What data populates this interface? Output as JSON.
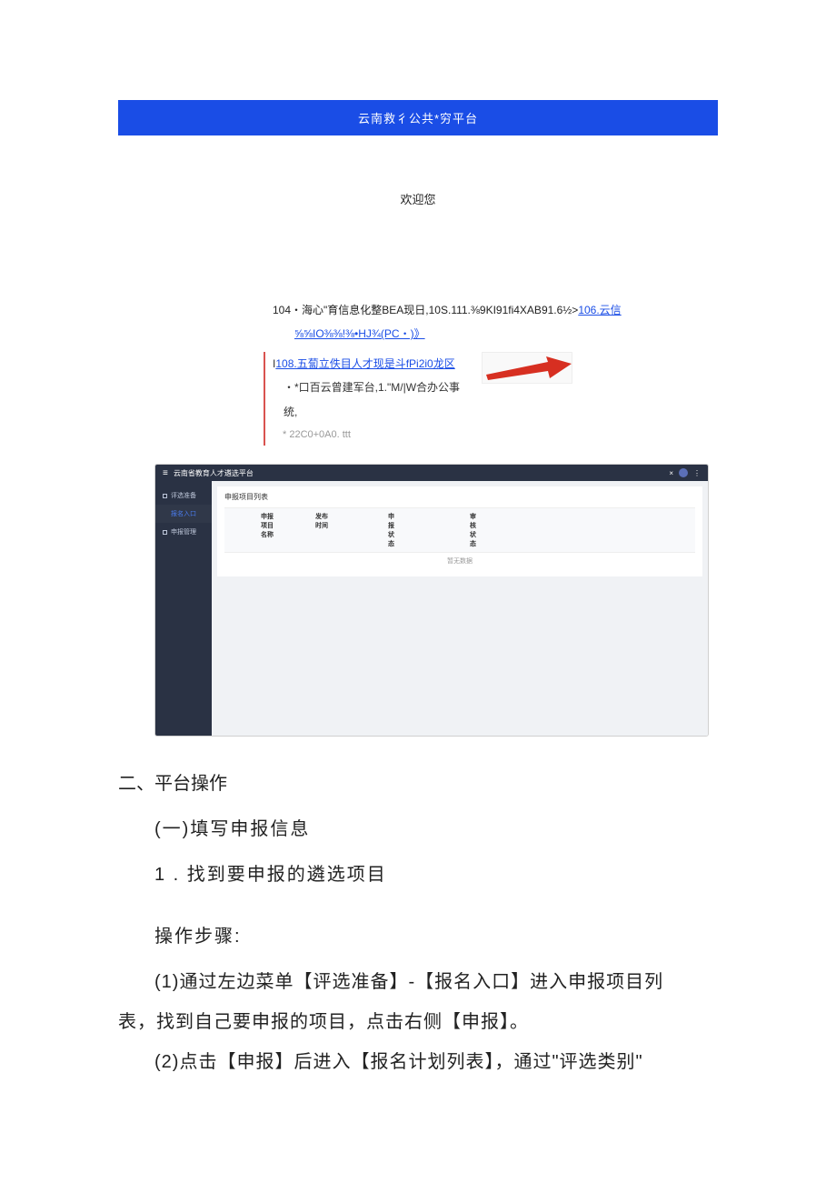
{
  "banner": {
    "title": "云南救彳公共*穷平台"
  },
  "welcome": "欢迎您",
  "link_block": {
    "prefix": "104・海心\"育信息化整BEA现日,10S.111.⅜9KI91fi4XAB91.6½>",
    "link1": "106.云信",
    "line2": "⅝⅝IO⅜⅜!⅜•HJ¾(PC・)》"
  },
  "callout": {
    "line1_prefix": "I",
    "line1_link": "108.五蔔立佚目人才现是斗fPi2i0龙区",
    "line2": "・*口百云曾建军台,1.\"M/|W合办公事统,",
    "line3": "* 22C0+0A0. ttt"
  },
  "screenshot": {
    "header_title": "云南省教育人才遴选平台",
    "close": "×",
    "more": "⋮",
    "sidebar": {
      "items": [
        {
          "label": "评选准备",
          "active": false
        },
        {
          "label": "报名入口",
          "active": true
        },
        {
          "label": "申报管理",
          "active": false
        }
      ]
    },
    "card_title": "申报项目列表",
    "table_headers": {
      "col1": "申报项目名称",
      "col2": "发布时间",
      "col3": "申报状态",
      "col4": "审核状态"
    },
    "empty": "暂无数据"
  },
  "doc": {
    "h2": "二、平台操作",
    "sub1": "(一)填写申报信息",
    "sub2": "1 . 找到要申报的遴选项目",
    "steps_label": "操作步骤:",
    "step1_a": "(1)通过左边菜单【评选准备】-【报名入口】进入申报项目列",
    "step1_b": "表，找到自己要申报的项目，点击右侧【申报】。",
    "step2": "(2)点击【申报】后进入【报名计划列表】，通过\"评选类别\""
  }
}
